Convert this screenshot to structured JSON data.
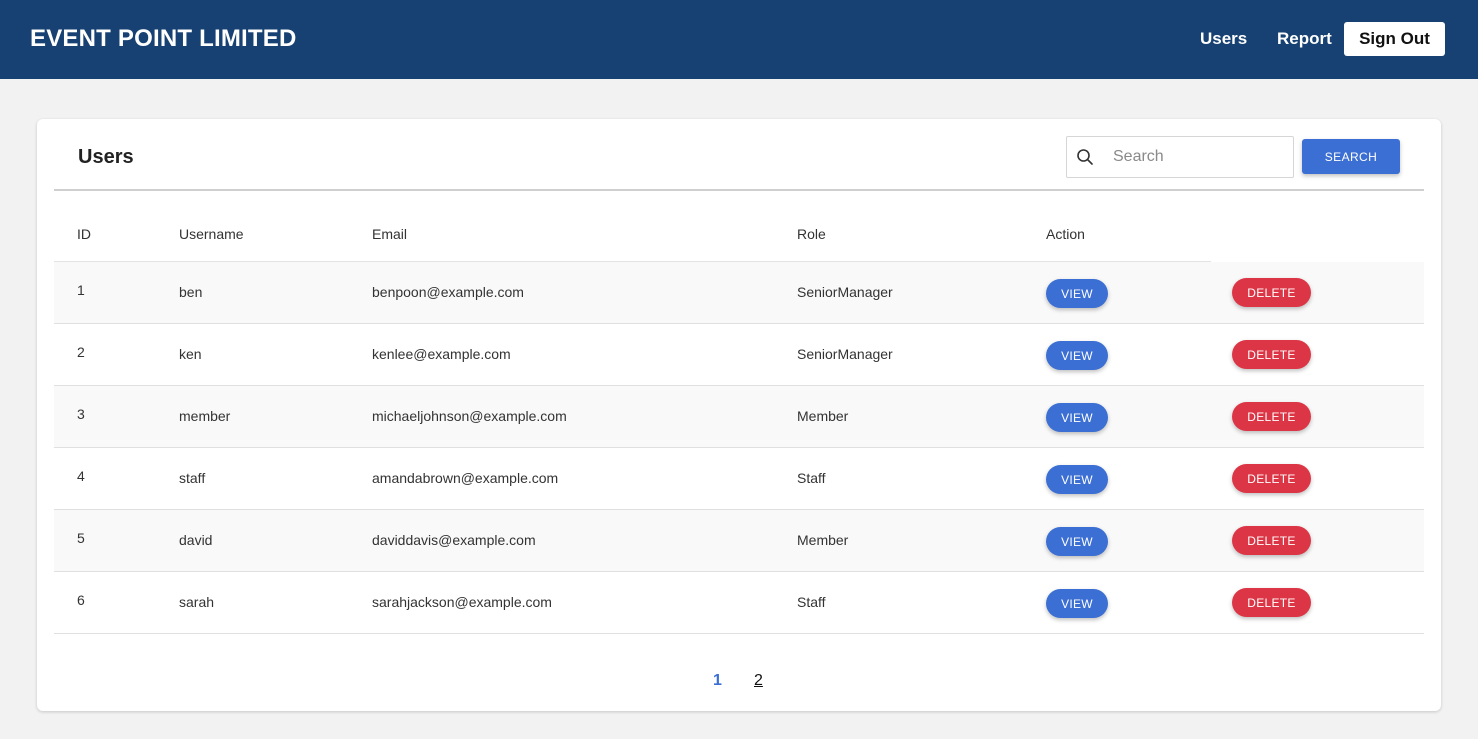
{
  "navbar": {
    "brand": "EVENT POINT LIMITED",
    "links": [
      {
        "label": "Users"
      },
      {
        "label": "Report"
      }
    ],
    "signout_label": "Sign Out",
    "bg_color": "#164172"
  },
  "users_card": {
    "title": "Users",
    "search": {
      "placeholder": "Search",
      "value": "",
      "button_label": "SEARCH",
      "icon": "search-icon"
    },
    "columns": [
      "ID",
      "Username",
      "Email",
      "Role",
      "Action"
    ],
    "rows": [
      {
        "id": "1",
        "username": "ben",
        "email": "benpoon@example.com",
        "role": "SeniorManager",
        "view_label": "VIEW",
        "delete_label": "DELETE"
      },
      {
        "id": "2",
        "username": "ken",
        "email": "kenlee@example.com",
        "role": "SeniorManager",
        "view_label": "VIEW",
        "delete_label": "DELETE"
      },
      {
        "id": "3",
        "username": "member",
        "email": "michaeljohnson@example.com",
        "role": "Member",
        "view_label": "VIEW",
        "delete_label": "DELETE"
      },
      {
        "id": "4",
        "username": "staff",
        "email": "amandabrown@example.com",
        "role": "Staff",
        "view_label": "VIEW",
        "delete_label": "DELETE"
      },
      {
        "id": "5",
        "username": "david",
        "email": "daviddavis@example.com",
        "role": "Member",
        "view_label": "VIEW",
        "delete_label": "DELETE"
      },
      {
        "id": "6",
        "username": "sarah",
        "email": "sarahjackson@example.com",
        "role": "Staff",
        "view_label": "VIEW",
        "delete_label": "DELETE"
      }
    ],
    "pagination": {
      "pages": [
        "1",
        "2"
      ],
      "current": "1"
    }
  },
  "colors": {
    "primary": "#3b6fd3",
    "danger": "#dc3545",
    "page_bg": "#f2f2f2"
  }
}
